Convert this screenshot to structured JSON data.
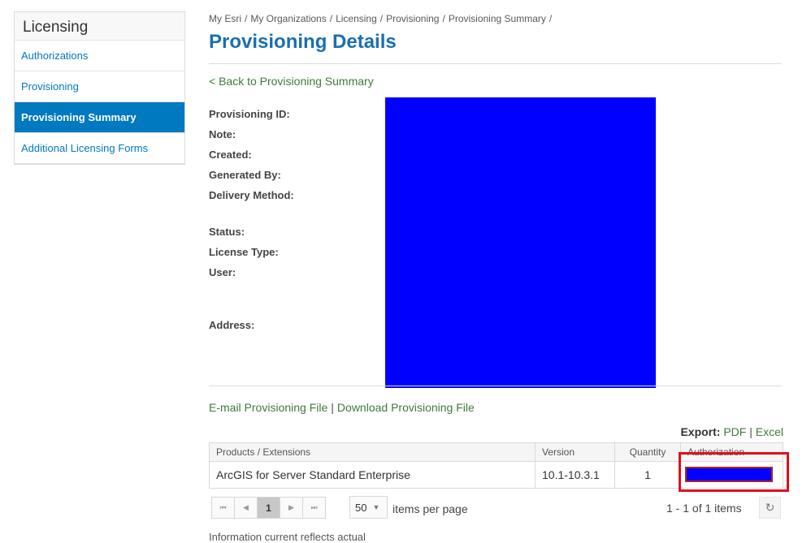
{
  "sidebar": {
    "title": "Licensing",
    "items": [
      {
        "label": "Authorizations"
      },
      {
        "label": "Provisioning"
      },
      {
        "label": "Provisioning Summary"
      },
      {
        "label": "Additional Licensing Forms"
      }
    ]
  },
  "breadcrumb": [
    "My Esri",
    "My Organizations",
    "Licensing",
    "Provisioning",
    "Provisioning Summary"
  ],
  "breadcrumb_sep": "/",
  "page": {
    "title": "Provisioning Details",
    "back_link": "< Back to Provisioning Summary"
  },
  "details": {
    "provisioning_id": "Provisioning ID:",
    "note": "Note:",
    "created": "Created:",
    "generated_by": "Generated By:",
    "delivery_method": "Delivery Method:",
    "status": "Status:",
    "license_type": "License Type:",
    "user": "User:",
    "address": "Address:"
  },
  "file_links": {
    "email": "E-mail Provisioning File",
    "separator": "|",
    "download": "Download Provisioning File"
  },
  "export": {
    "label": "Export:",
    "pdf": "PDF",
    "separator": "|",
    "excel": "Excel"
  },
  "table": {
    "headers": {
      "products": "Products / Extensions",
      "version": "Version",
      "quantity": "Quantity",
      "authorization": "Authorization"
    },
    "rows": [
      {
        "product": "ArcGIS for Server Standard Enterprise",
        "version": "10.1-10.3.1",
        "quantity": "1"
      }
    ]
  },
  "pager": {
    "first": "⏮",
    "prev": "◀",
    "current": "1",
    "next": "▶",
    "last": "⏭",
    "page_size": "50",
    "per_page_label": "items per page",
    "range": "1 - 1 of 1 items"
  },
  "footnote": "Information current reflects actual",
  "colors": {
    "accent": "#0079c1",
    "title": "#1a6fb0",
    "link_green": "#3f7a3a",
    "redaction": "#0000ff",
    "highlight": "#e0101a"
  }
}
